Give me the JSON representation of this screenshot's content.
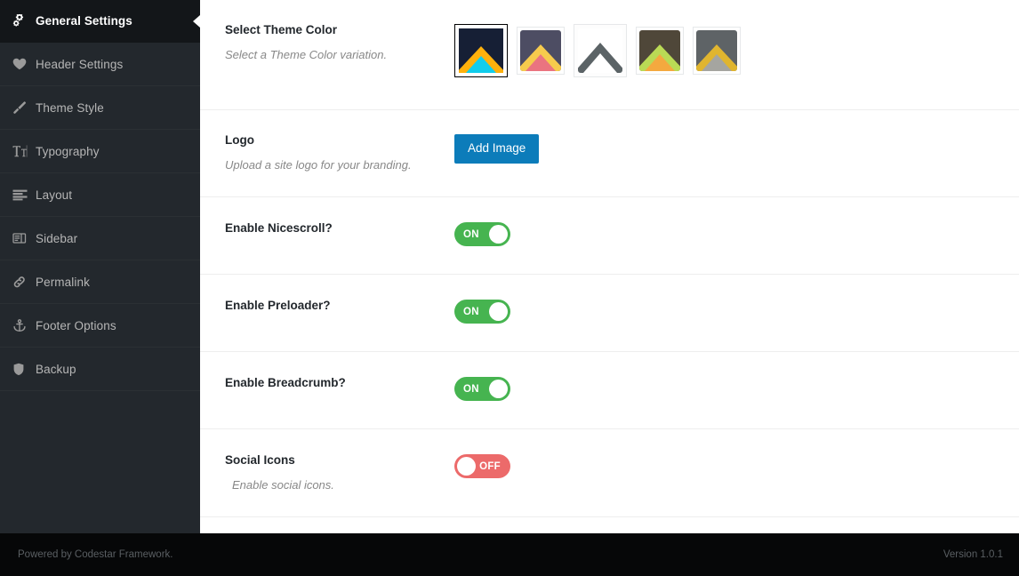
{
  "sidebar": {
    "items": [
      {
        "label": "General Settings",
        "icon": "cogs-icon",
        "active": true
      },
      {
        "label": "Header Settings",
        "icon": "heart-icon",
        "active": false
      },
      {
        "label": "Theme Style",
        "icon": "paintbrush-icon",
        "active": false
      },
      {
        "label": "Typography",
        "icon": "typography-icon",
        "active": false
      },
      {
        "label": "Layout",
        "icon": "layout-icon",
        "active": false
      },
      {
        "label": "Sidebar",
        "icon": "sidebar-icon",
        "active": false
      },
      {
        "label": "Permalink",
        "icon": "link-icon",
        "active": false
      },
      {
        "label": "Footer Options",
        "icon": "anchor-icon",
        "active": false
      },
      {
        "label": "Backup",
        "icon": "shield-icon",
        "active": false
      }
    ]
  },
  "fields": {
    "theme_color": {
      "title": "Select Theme Color",
      "subtitle": "Select a Theme Color variation.",
      "swatches": [
        {
          "name": "navy-cyan",
          "bg": "#161f35",
          "outer": "#feb10c",
          "inner": "#11cdec",
          "state": "selected"
        },
        {
          "name": "purple-pink",
          "bg": "#4d4d63",
          "outer": "#f6cb4d",
          "inner": "#ea7480",
          "state": "normal"
        },
        {
          "name": "white-gray",
          "bg": "#ffffff",
          "outer": "#5b6366",
          "inner": "#ffffff",
          "state": "active-light"
        },
        {
          "name": "olive-green",
          "bg": "#4f4739",
          "outer": "#bada55",
          "inner": "#f5a council",
          "state": "normal"
        },
        {
          "name": "gray-gold",
          "bg": "#5e6366",
          "outer": "#e0b52f",
          "inner": "#a5a5a0",
          "state": "normal"
        }
      ]
    },
    "logo": {
      "title": "Logo",
      "subtitle": "Upload a site logo for your branding.",
      "button_label": "Add Image"
    },
    "nicescroll": {
      "title": "Enable Nicescroll?",
      "subtitle": "",
      "toggle_state": "on",
      "toggle_label": "ON"
    },
    "preloader": {
      "title": "Enable Preloader?",
      "subtitle": "",
      "toggle_state": "on",
      "toggle_label": "ON"
    },
    "breadcrumb": {
      "title": "Enable Breadcrumb?",
      "subtitle": "",
      "toggle_state": "on",
      "toggle_label": "ON"
    },
    "social_icons": {
      "title": "Social Icons",
      "subtitle": "Enable social icons.",
      "toggle_state": "off",
      "toggle_label": "OFF"
    }
  },
  "footer": {
    "powered_by": "Powered by Codestar Framework.",
    "version": "Version 1.0.1"
  },
  "colors": {
    "sidebar_bg": "#23282d",
    "sidebar_active_bg": "#131619",
    "button_blue": "#0c7cba",
    "toggle_on": "#46b450",
    "toggle_off": "#ec6a6a",
    "footer_bg": "#060708"
  }
}
